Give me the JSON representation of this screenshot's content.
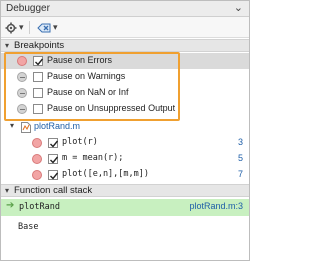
{
  "window": {
    "title": "Debugger",
    "menu_glyph": "⌄"
  },
  "toolbar": {
    "settings_icon": "gear-icon",
    "settings_dropdown": "▾",
    "breakpoint_icon": "breakpoint-clear-icon",
    "breakpoint_dropdown": "▾"
  },
  "breakpoints": {
    "header": "Breakpoints",
    "pause_options": [
      {
        "label": "Pause on Errors",
        "checked": true,
        "enabled": true
      },
      {
        "label": "Pause on Warnings",
        "checked": false,
        "enabled": false
      },
      {
        "label": "Pause on NaN or Inf",
        "checked": false,
        "enabled": false
      },
      {
        "label": "Pause on Unsuppressed Output",
        "checked": false,
        "enabled": false
      }
    ],
    "file": {
      "name": "plotRand.m",
      "lines": [
        {
          "code": "plot(r)",
          "line": "3",
          "checked": true
        },
        {
          "code": "m = mean(r);",
          "line": "5",
          "checked": true
        },
        {
          "code": "plot([e,n],[m,m])",
          "line": "7",
          "checked": true
        }
      ]
    }
  },
  "call_stack": {
    "header": "Function call stack",
    "frames": [
      {
        "name": "plotRand",
        "location": "plotRand.m:3",
        "current": true
      },
      {
        "name": "Base",
        "location": "",
        "current": false
      }
    ]
  },
  "colors": {
    "highlight_border": "#f0a030",
    "current_frame_bg": "#c8f0c0",
    "link": "#1f5fa8",
    "breakpoint_enabled": "#f2a5a5"
  }
}
